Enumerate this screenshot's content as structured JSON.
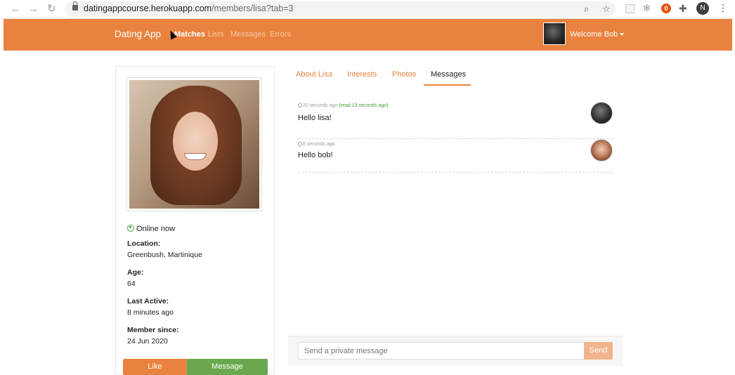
{
  "browser": {
    "back_icon": "←",
    "forward_icon": "→",
    "reload_icon": "↻",
    "url_host": "datingappcourse.herokuapp.com",
    "url_path": "/members/lisa?tab=3",
    "profile_initial": "N",
    "ext_initial": "0"
  },
  "navbar": {
    "brand": "Dating App",
    "links": [
      "Matches",
      "Lists",
      "Messages",
      "Errors"
    ],
    "active_link": "Matches",
    "welcome": "Welcome Bob",
    "accent_color": "#e9823e"
  },
  "profile": {
    "status": "Online now",
    "location_label": "Location:",
    "location_value": "Greenbush, Martinique",
    "age_label": "Age:",
    "age_value": "64",
    "last_active_label": "Last Active:",
    "last_active_value": "8 minutes ago",
    "member_since_label": "Member since:",
    "member_since_value": "24 Jun 2020",
    "like_label": "Like",
    "message_label": "Message"
  },
  "tabs": [
    "About Lisa",
    "Interests",
    "Photos",
    "Messages"
  ],
  "active_tab": "Messages",
  "messages": [
    {
      "time": "20 seconds ago",
      "read": "(read 13 seconds ago)",
      "text": "Hello lisa!",
      "sender": "bob"
    },
    {
      "time": "8 seconds ago",
      "read": "",
      "text": "Hello bob!",
      "sender": "lisa"
    }
  ],
  "send": {
    "placeholder": "Send a private message",
    "button_label": "Send"
  }
}
